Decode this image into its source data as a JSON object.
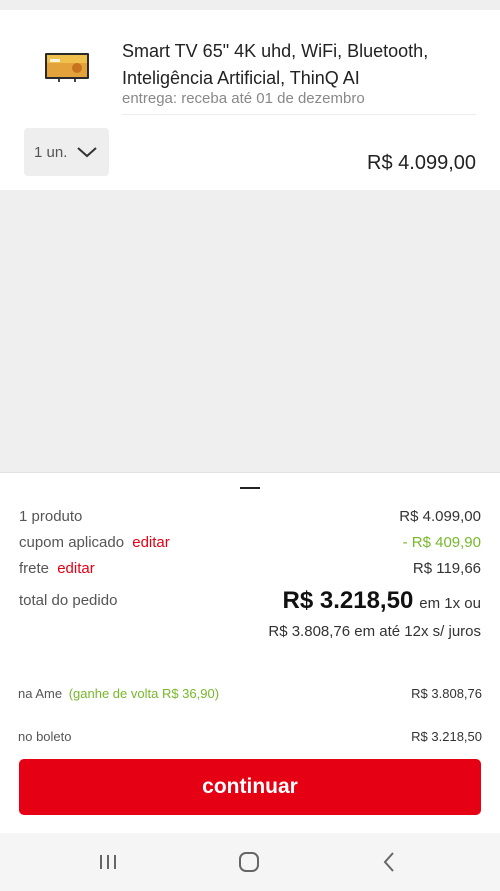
{
  "product": {
    "title": "Smart TV 65\" 4K uhd, WiFi, Bluetooth, Inteligência Artificial, ThinQ AI",
    "delivery": "entrega: receba até 01 de dezembro",
    "quantity": "1 un.",
    "price": "R$ 4.099,00",
    "thumbnail_icon": "tv-thumbnail-icon"
  },
  "summary": {
    "products_label": "1 produto",
    "products_value": "R$ 4.099,00",
    "coupon_label": "cupom aplicado",
    "coupon_edit": "editar",
    "coupon_value": "- R$ 409,90",
    "shipping_label": "frete",
    "shipping_edit": "editar",
    "shipping_value": "R$ 119,66",
    "total_label": "total do pedido",
    "total_value": "R$ 3.218,50",
    "total_suffix": "em 1x ou",
    "installments": "R$ 3.808,76 em até 12x s/ juros",
    "ame_label": "na Ame",
    "ame_cashback": "(ganhe de volta R$ 36,90)",
    "ame_value": "R$ 3.808,76",
    "boleto_label": "no boleto",
    "boleto_value": "R$ 3.218,50"
  },
  "actions": {
    "continue_label": "continuar"
  },
  "colors": {
    "accent": "#e60014",
    "discount": "#76b82a"
  },
  "navbar": {
    "recents_icon": "recents-icon",
    "home_icon": "home-icon",
    "back_icon": "back-icon"
  }
}
